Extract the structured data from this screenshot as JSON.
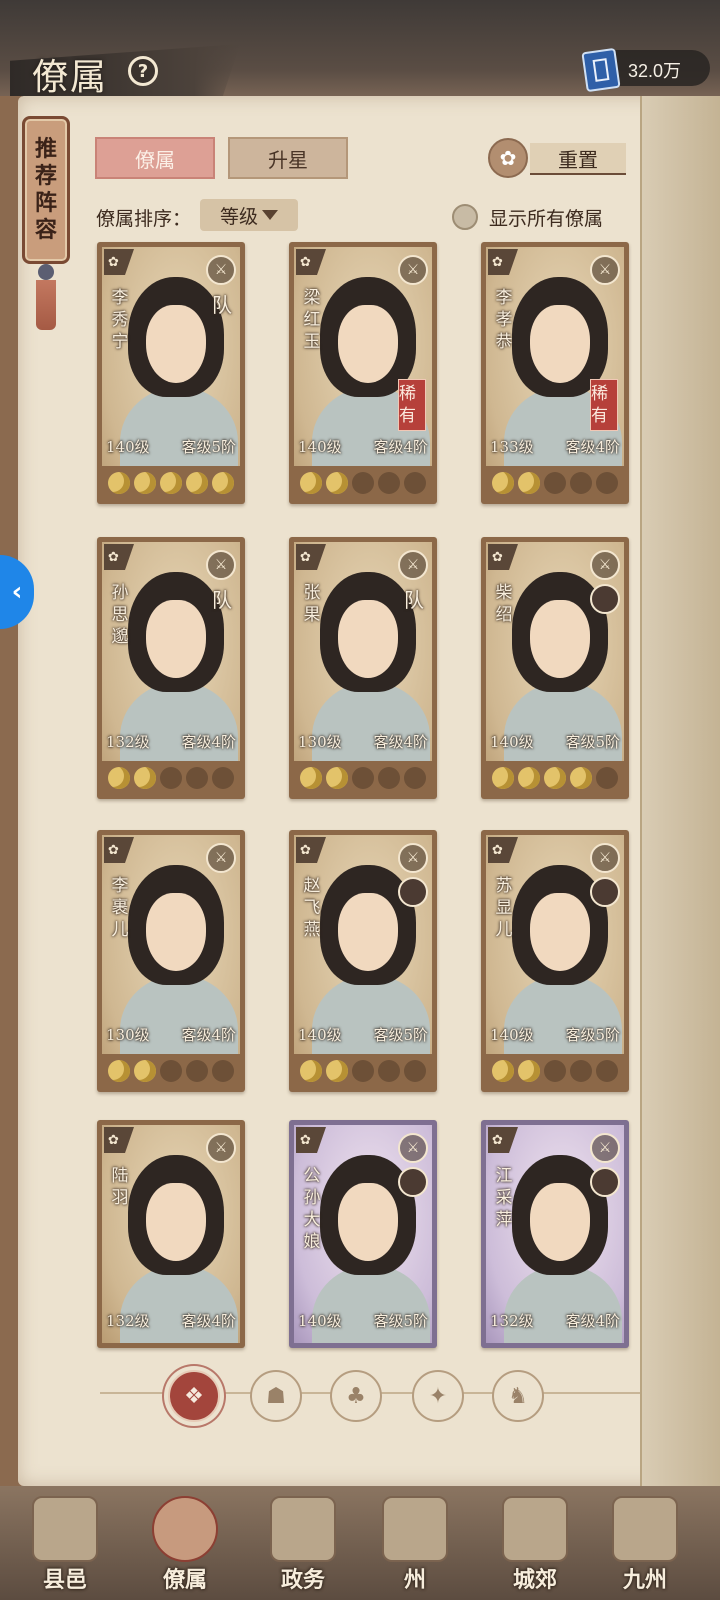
{
  "header": {
    "title": "僚属",
    "help_icon": "question-icon",
    "currency_icon": "book-icon",
    "currency_value": "32.0万"
  },
  "recommend": {
    "label_chars": [
      "推",
      "荐",
      "阵",
      "容"
    ]
  },
  "tabs": [
    {
      "label": "僚属",
      "active": true
    },
    {
      "label": "升星",
      "active": false
    }
  ],
  "reset": {
    "label": "重置",
    "icon": "reset-icon"
  },
  "sort": {
    "label": "僚属排序：",
    "selected": "等级"
  },
  "show_all": {
    "label": "显示所有僚属",
    "checked": false
  },
  "cards": [
    {
      "name_chars": [
        "李",
        "秀",
        "宁"
      ],
      "level": "140级",
      "rank": "客级5阶",
      "stars_on": 5,
      "team": "队",
      "rare": "",
      "frame": "gold"
    },
    {
      "name_chars": [
        "梁",
        "红",
        "玉"
      ],
      "level": "140级",
      "rank": "客级4阶",
      "stars_on": 2,
      "team": "",
      "rare": "稀有",
      "frame": "gold"
    },
    {
      "name_chars": [
        "李",
        "孝",
        "恭"
      ],
      "level": "133级",
      "rank": "客级4阶",
      "stars_on": 2,
      "team": "",
      "rare": "稀有",
      "frame": "gold"
    },
    {
      "name_chars": [
        "孙",
        "思",
        "邈"
      ],
      "level": "132级",
      "rank": "客级4阶",
      "stars_on": 2,
      "team": "队",
      "rare": "",
      "frame": "gold"
    },
    {
      "name_chars": [
        "张",
        "果"
      ],
      "level": "130级",
      "rank": "客级4阶",
      "stars_on": 2,
      "team": "队",
      "rare": "",
      "frame": "gold"
    },
    {
      "name_chars": [
        "柴",
        "绍"
      ],
      "level": "140级",
      "rank": "客级5阶",
      "stars_on": 4,
      "team": "",
      "rare": "",
      "frame": "gold"
    },
    {
      "name_chars": [
        "李",
        "裹",
        "儿"
      ],
      "level": "130级",
      "rank": "客级4阶",
      "stars_on": 2,
      "team": "",
      "rare": "",
      "frame": "gold"
    },
    {
      "name_chars": [
        "赵",
        "飞",
        "燕"
      ],
      "level": "140级",
      "rank": "客级5阶",
      "stars_on": 2,
      "team": "",
      "rare": "",
      "frame": "gold"
    },
    {
      "name_chars": [
        "苏",
        "显",
        "儿"
      ],
      "level": "140级",
      "rank": "客级5阶",
      "stars_on": 2,
      "team": "",
      "rare": "",
      "frame": "gold"
    },
    {
      "name_chars": [
        "陆",
        "羽"
      ],
      "level": "132级",
      "rank": "客级4阶",
      "stars_on": 0,
      "team": "",
      "rare": "",
      "frame": "gold"
    },
    {
      "name_chars": [
        "公",
        "孙",
        "大",
        "娘"
      ],
      "level": "140级",
      "rank": "客级5阶",
      "stars_on": 0,
      "team": "",
      "rare": "",
      "frame": "purple"
    },
    {
      "name_chars": [
        "江",
        "采",
        "萍"
      ],
      "level": "132级",
      "rank": "客级4阶",
      "stars_on": 0,
      "team": "",
      "rare": "",
      "frame": "purple"
    }
  ],
  "filters": [
    "all-filter-icon",
    "scholar-filter-icon",
    "gourd-filter-icon",
    "fan-filter-icon",
    "beast-filter-icon"
  ],
  "bottom_nav": [
    {
      "label": "县邑",
      "icon": "town-icon"
    },
    {
      "label": "僚属",
      "icon": "retainers-icon",
      "active": true
    },
    {
      "label": "政务",
      "icon": "affairs-icon"
    },
    {
      "label": "州",
      "icon": "prefecture-icon"
    },
    {
      "label": "城郊",
      "icon": "suburbs-icon"
    },
    {
      "label": "九州",
      "icon": "map-icon"
    }
  ],
  "colors": {
    "accent_red": "#a3453c",
    "parchment": "#ece2cf",
    "gold_frame": "#8c6848",
    "purple_frame": "#7e6f91",
    "star_on": "#e3c36a"
  }
}
